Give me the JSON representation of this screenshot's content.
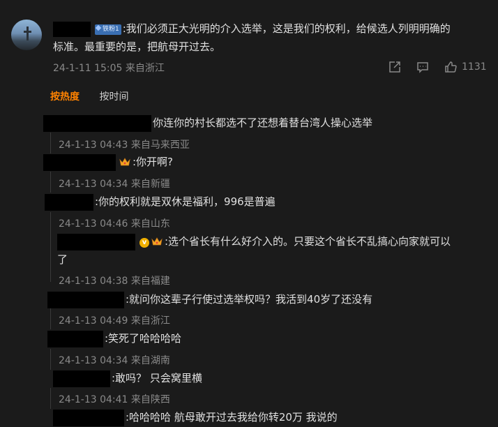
{
  "post": {
    "badge": "铁粉1",
    "text_line1": ":我们必须正大光明的介入选举，这是我们的权利，给候选人列明明确的",
    "text_line2": "标准。最重要的是，把航母开过去。",
    "meta": "24-1-11 15:05 来自浙江",
    "like_count": "1131",
    "icons": [
      "share-icon",
      "comment-icon",
      "like-icon"
    ]
  },
  "sort": {
    "hot": "按热度",
    "time": "按时间"
  },
  "replies": [
    {
      "text": "你连你的村长都选不了还想着替台湾人操心选举",
      "meta": "24-1-13 04:43 来自马来西亚"
    },
    {
      "text": ":你开啊?",
      "meta": "24-1-13 04:34 来自新疆"
    },
    {
      "text": ":你的权利就是双休是福利，996是普遍",
      "meta": "24-1-13 04:46 来自山东"
    },
    {
      "text_line1": ":选个省长有什么好介入的。只要这个省长不乱搞心向家就可以",
      "text_line2": "了",
      "vip": "v",
      "meta": "24-1-13 04:38 来自福建"
    },
    {
      "text": ":就问你这辈子行使过选举权吗？我活到40岁了还没有",
      "meta": "24-1-13 04:49 来自浙江"
    },
    {
      "text": ":笑死了哈哈哈哈",
      "meta": "24-1-13 04:34 来自湖南"
    },
    {
      "text": ":敢吗？ 只会窝里横",
      "meta": "24-1-13 04:41 来自陕西"
    },
    {
      "text": ":哈哈哈哈 航母敢开过去我给你转20万  我说的"
    }
  ]
}
